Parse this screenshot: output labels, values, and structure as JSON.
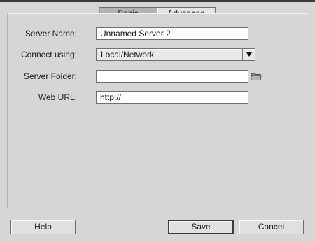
{
  "tabs": {
    "basic": "Basic",
    "advanced": "Advanced",
    "selected": "Basic"
  },
  "form": {
    "server_name": {
      "label": "Server Name:",
      "value": "Unnamed Server 2"
    },
    "connect_using": {
      "label": "Connect using:",
      "value": "Local/Network"
    },
    "server_folder": {
      "label": "Server Folder:",
      "value": ""
    },
    "web_url": {
      "label": "Web URL:",
      "value": "http://"
    }
  },
  "buttons": {
    "help": "Help",
    "save": "Save",
    "cancel": "Cancel"
  },
  "icons": {
    "folder": "folder-icon",
    "dropdown": "chevron-down-icon"
  },
  "colors": {
    "background": "#d6d6d6",
    "field_bg": "#ffffff",
    "selected_tab": "#b3b3b3"
  }
}
